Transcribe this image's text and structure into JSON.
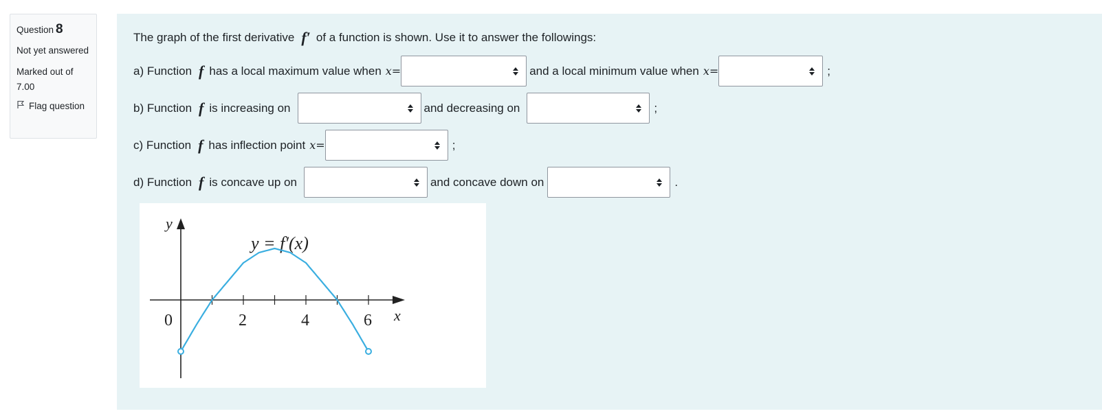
{
  "info": {
    "question_label": "Question",
    "question_number": "8",
    "state": "Not yet answered",
    "grade": "Marked out of 7.00",
    "flag_label": "Flag question"
  },
  "question": {
    "intro_pre": "The graph of the first derivative",
    "intro_func": "f′",
    "intro_post": "of a function  is shown. Use it to answer the followings:",
    "f_symbol": "f",
    "x_eq": "x=",
    "a_pre": "a) Function",
    "a_mid": "has a local maximum value when",
    "a_and": "and a local minimum value when",
    "a_end": ";",
    "b_pre": "b) Function",
    "b_mid": "is increasing on",
    "b_and": "and decreasing on",
    "b_end": ";",
    "c_pre": "c) Function",
    "c_mid": "has inflection point",
    "c_end": ";",
    "d_pre": "d) Function",
    "d_mid": "is concave up on",
    "d_and": "and concave down on",
    "d_end": ".",
    "selects": [
      "",
      "",
      "",
      "",
      "",
      "",
      "",
      ""
    ]
  },
  "graph": {
    "y_axis_label": "y",
    "x_axis_label": "x",
    "curve_label": "y = f′(x)",
    "tick_labels": [
      "0",
      "2",
      "4",
      "6"
    ],
    "curve_color": "#3aaee0"
  },
  "chart_data": {
    "type": "line",
    "title": "",
    "xlabel": "x",
    "ylabel": "y",
    "x": [
      0,
      0.5,
      1,
      1.5,
      2,
      2.5,
      3,
      3.5,
      4,
      4.5,
      5,
      5.5,
      6
    ],
    "series": [
      {
        "name": "y = f′(x)",
        "values": [
          -2.5,
          -1.2,
          0,
          0.9,
          1.8,
          2.3,
          2.5,
          2.3,
          1.8,
          0.9,
          0,
          -1.2,
          -2.5
        ]
      }
    ],
    "xlim": [
      0,
      6
    ],
    "grid": false
  }
}
